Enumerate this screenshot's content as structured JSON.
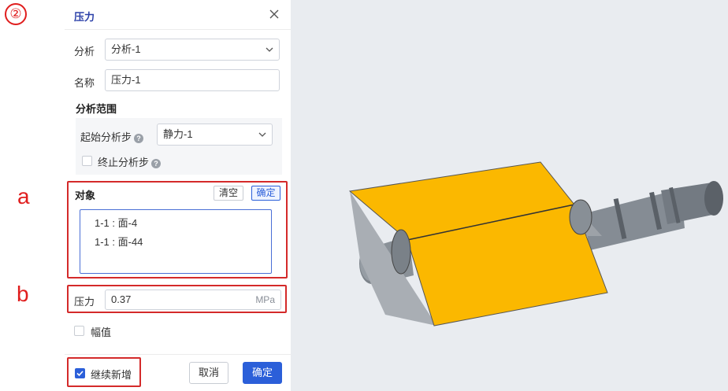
{
  "annotations": {
    "step": "②",
    "a": "a",
    "b": "b"
  },
  "dialog": {
    "title": "压力",
    "analysis_label": "分析",
    "analysis_value": "分析-1",
    "name_label": "名称",
    "name_value": "压力-1",
    "range_title": "分析范围",
    "start_step_label": "起始分析步",
    "start_step_value": "静力-1",
    "end_step_label": "终止分析步",
    "target_label": "对象",
    "clear_label": "清空",
    "confirm_small_label": "确定",
    "target_items": [
      "1-1 : 面-4",
      "1-1 : 面-44"
    ],
    "pressure_label": "压力",
    "pressure_value": "0.37",
    "pressure_unit": "MPa",
    "amplitude_label": "幅值",
    "continue_label": "继续新增",
    "cancel_label": "取消",
    "ok_label": "确定"
  },
  "colors": {
    "accent": "#2b5fd9",
    "highlight": "#d42a2a",
    "part": "#fbb800"
  }
}
